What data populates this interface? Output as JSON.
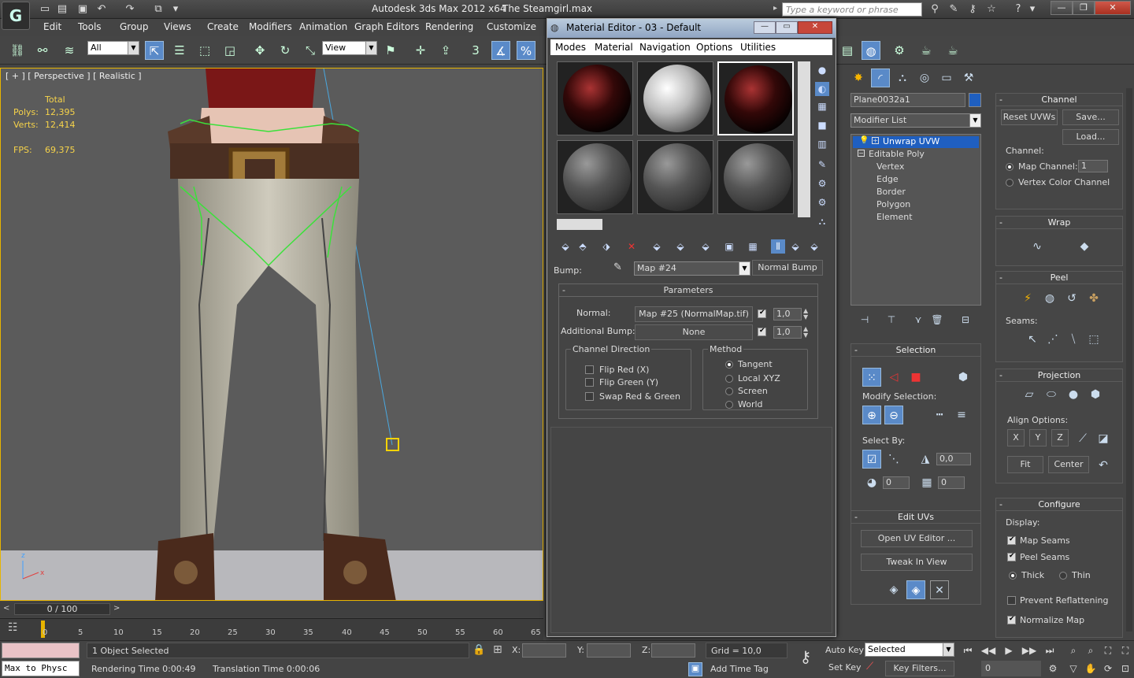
{
  "app": {
    "title": "Autodesk 3ds Max  2012 x64",
    "file": "The Steamgirl.max",
    "search_placeholder": "Type a keyword or phrase"
  },
  "menu": [
    "Edit",
    "Tools",
    "Group",
    "Views",
    "Create",
    "Modifiers",
    "Animation",
    "Graph Editors",
    "Rendering",
    "Customize"
  ],
  "toolbar": {
    "selection_filter": "All",
    "ref_coord": "View",
    "snap_number": "3"
  },
  "viewport": {
    "label": "[ + ] [ Perspective ] [ Realistic ]",
    "stats_header": "Total",
    "polys_label": "Polys:",
    "polys_value": "12,395",
    "verts_label": "Verts:",
    "verts_value": "12,414",
    "fps_label": "FPS:",
    "fps_value": "69,375",
    "axis_z": "z",
    "axis_x": "x"
  },
  "timeline": {
    "slider": "0 / 100",
    "ticks": [
      "0",
      "5",
      "10",
      "15",
      "20",
      "25",
      "30",
      "35",
      "40",
      "45",
      "50",
      "55",
      "60",
      "65"
    ]
  },
  "status": {
    "maxscript": "Max to Physc",
    "selected": "1 Object Selected",
    "render_time": "Rendering Time  0:00:49",
    "translation_time": "Translation Time  0:00:06",
    "x_label": "X:",
    "y_label": "Y:",
    "z_label": "Z:",
    "grid": "Grid = 10,0",
    "add_time_tag": "Add Time Tag",
    "auto_key": "Auto Key",
    "set_key": "Set Key",
    "selected_combo": "Selected",
    "key_filters": "Key Filters...",
    "frame_value": "0"
  },
  "material_editor": {
    "title": "Material Editor - 03 - Default",
    "menu": [
      "Modes",
      "Material",
      "Navigation",
      "Options",
      "Utilities"
    ],
    "bump_label": "Bump:",
    "map_name": "Map #24",
    "map_type": "Normal Bump",
    "params_title": "Parameters",
    "normal_label": "Normal:",
    "normal_map": "Map #25 (NormalMap.tif)",
    "normal_amount": "1,0",
    "additional_bump_label": "Additional Bump:",
    "additional_bump_map": "None",
    "additional_amount": "1,0",
    "channel_direction_title": "Channel Direction",
    "flip_red": "Flip Red (X)",
    "flip_green": "Flip Green (Y)",
    "swap": "Swap Red & Green",
    "method_title": "Method",
    "methods": [
      "Tangent",
      "Local XYZ",
      "Screen",
      "World"
    ]
  },
  "command_panel": {
    "object_name": "Plane0032a1",
    "object_color": "#1f5fc0",
    "modifier_list": "Modifier List",
    "stack": [
      "Unwrap UVW",
      "Editable Poly",
      "Vertex",
      "Edge",
      "Border",
      "Polygon",
      "Element"
    ],
    "selection_title": "Selection",
    "modify_selection": "Modify Selection:",
    "select_by": "Select By:",
    "spin_a": "0,0",
    "spin_b": "0",
    "spin_c": "0",
    "edit_uvs_title": "Edit UVs",
    "open_uv_editor": "Open UV Editor ...",
    "tweak_in_view": "Tweak In View",
    "channel_title": "Channel",
    "reset_uvws": "Reset UVWs",
    "save": "Save...",
    "load": "Load...",
    "channel_label": "Channel:",
    "map_channel": "Map Channel:",
    "map_channel_value": "1",
    "vertex_color_channel": "Vertex Color Channel",
    "wrap_title": "Wrap",
    "peel_title": "Peel",
    "seams_label": "Seams:",
    "projection_title": "Projection",
    "align_options": "Align Options:",
    "align_x": "X",
    "align_y": "Y",
    "align_z": "Z",
    "fit": "Fit",
    "center": "Center",
    "configure_title": "Configure",
    "display_label": "Display:",
    "map_seams": "Map Seams",
    "peel_seams": "Peel Seams",
    "thick": "Thick",
    "thin": "Thin",
    "prevent_reflattening": "Prevent Reflattening",
    "normalize_map": "Normalize Map"
  }
}
